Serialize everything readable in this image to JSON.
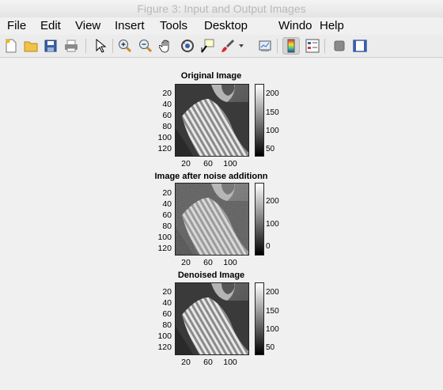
{
  "window": {
    "title": "Figure 3: Input and Output Images"
  },
  "menu": [
    "File",
    "Edit",
    "View",
    "Insert",
    "Tools",
    "Desktop",
    "Windo",
    "Help"
  ],
  "toolbar_icons": [
    "new-figure-icon",
    "open-file-icon",
    "save-icon",
    "print-icon",
    "pointer-icon",
    "zoom-in-icon",
    "zoom-out-icon",
    "pan-hand-icon",
    "rotate-3d-icon",
    "data-cursor-icon",
    "brush-icon",
    "brush-dropdown-icon",
    "link-plot-icon",
    "colorbar-icon",
    "legend-icon",
    "hide-plot-tools-icon",
    "show-plot-tools-icon"
  ],
  "plots": [
    {
      "title": "Original Image",
      "yticks": [
        "20",
        "40",
        "60",
        "80",
        "100",
        "120"
      ],
      "xticks": [
        "20",
        "60",
        "100"
      ],
      "cbar_ticks": [
        "200",
        "150",
        "100",
        "50"
      ]
    },
    {
      "title": "Image after noise additionn",
      "yticks": [
        "20",
        "40",
        "60",
        "80",
        "100",
        "120"
      ],
      "xticks": [
        "20",
        "60",
        "100"
      ],
      "cbar_ticks": [
        "200",
        "100",
        "0"
      ]
    },
    {
      "title": "Denoised Image",
      "yticks": [
        "20",
        "40",
        "60",
        "80",
        "100",
        "120"
      ],
      "xticks": [
        "20",
        "60",
        "100"
      ],
      "cbar_ticks": [
        "200",
        "150",
        "100",
        "50"
      ]
    }
  ]
}
